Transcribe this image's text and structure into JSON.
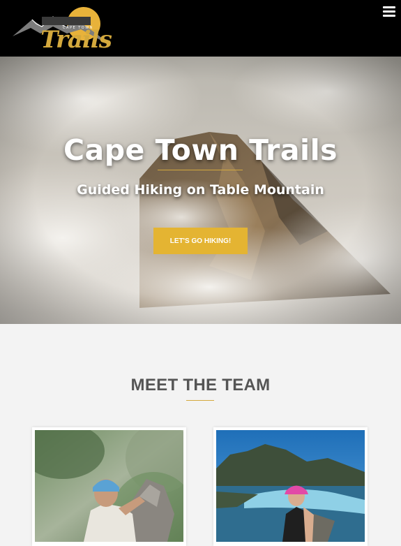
{
  "header": {
    "logo": {
      "small_text": "CAPE TOWN",
      "script_text": "Trails",
      "icon": "mountain-sun-logo"
    },
    "menu": {
      "icon": "hamburger-menu-icon"
    }
  },
  "hero": {
    "title": "Cape Town Trails",
    "subtitle": "Guided Hiking on Table Mountain",
    "cta_label": "LET'S GO HIKING!"
  },
  "team": {
    "title": "MEET THE TEAM",
    "members": [
      {
        "photo": "guide-climbing-rock-photo"
      },
      {
        "photo": "guide-sitting-above-bay-photo"
      }
    ]
  },
  "colors": {
    "accent": "#d4a93d",
    "button": "#e4b432",
    "header_bg": "#000000",
    "page_bg": "#f3f3f3",
    "heading_text": "#555555"
  }
}
